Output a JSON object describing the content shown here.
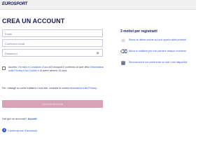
{
  "header": {
    "logo_text": "EUROSPORT"
  },
  "page": {
    "title": "CREA UN ACCOUNT"
  },
  "form": {
    "email_placeholder": "Email",
    "email_confirm_placeholder": "Conferma email",
    "password_placeholder": "Password",
    "password_icon": "eye-icon",
    "consent": {
      "text_before": "Accetto i",
      "terms_link": "Termini e Condizioni d'uso",
      "text_middle": "di Eurosport e confermo di aver letto l'",
      "privacy_link": "Informativa sulla Privacy e sui Cookie",
      "text_after": "e di avere almeno 16 anni."
    },
    "notice": {
      "text_before": "Per i dettagli su come trattiamo i tuoi dati, consulta la nostra",
      "privacy_link": "Informativa sulla Privacy."
    },
    "submit_label": "Crea un account"
  },
  "login": {
    "question": "Hai già un account?",
    "link": "Accedi"
  },
  "social": {
    "facebook_label": "Continua con Facebook",
    "facebook_icon": "facebook-icon"
  },
  "reasons": {
    "title": "3 motivi per registrarti",
    "items": [
      {
        "icon": "star-icon",
        "text": "Ricevi le ultime notizie sui tuoi sport e atleti preferiti"
      },
      {
        "icon": "bell-icon",
        "text": "Attiva le notifiche per non perdere nessun momento"
      },
      {
        "icon": "device-icon",
        "text": "Sincronizza le tue preferenze su tutti i tuoi dispositivi"
      }
    ]
  },
  "colors": {
    "brand": "#141b4d",
    "link": "#2f56d6",
    "submit_bg": "#d8a3b6"
  }
}
